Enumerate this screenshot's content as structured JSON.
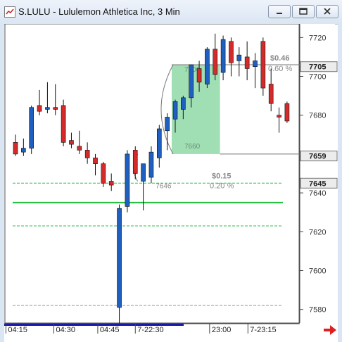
{
  "window": {
    "title": "S.LULU - Lululemon Athletica Inc, 3 Min",
    "minimize_icon": "minimize-icon",
    "restore_icon": "restore-icon",
    "close_icon": "close-icon"
  },
  "chart_data": {
    "type": "candlestick",
    "title": "S.LULU - Lululemon Athletica Inc, 3 Min",
    "ylim": [
      7573,
      7727
    ],
    "y_ticks": [
      7580,
      7600,
      7620,
      7640,
      7660,
      7680,
      7700,
      7720
    ],
    "y_tick_labels": [
      "7580",
      "7600",
      "7620",
      "7640",
      "7660",
      "7680",
      "7700",
      "7720"
    ],
    "x_tick_labels": [
      {
        "label": "04:15",
        "index": 0.3
      },
      {
        "label": "04:30",
        "index": 6.3
      },
      {
        "label": "04:45",
        "index": 11.8
      },
      {
        "label": "7-22:30",
        "index": 16.5
      },
      {
        "label": "23:00",
        "index": 25.8
      },
      {
        "label": "7-23:15",
        "index": 30.6
      }
    ],
    "candles": [
      {
        "o": 7666,
        "h": 7670,
        "l": 7659,
        "c": 7660
      },
      {
        "o": 7661,
        "h": 7668,
        "l": 7659,
        "c": 7663
      },
      {
        "o": 7663,
        "h": 7685,
        "l": 7660,
        "c": 7684
      },
      {
        "o": 7685,
        "h": 7693,
        "l": 7680,
        "c": 7682
      },
      {
        "o": 7683,
        "h": 7697,
        "l": 7681,
        "c": 7684
      },
      {
        "o": 7684,
        "h": 7696,
        "l": 7680,
        "c": 7683
      },
      {
        "o": 7685,
        "h": 7688,
        "l": 7664,
        "c": 7666
      },
      {
        "o": 7667,
        "h": 7671,
        "l": 7663,
        "c": 7665
      },
      {
        "o": 7664,
        "h": 7672,
        "l": 7660,
        "c": 7662
      },
      {
        "o": 7662,
        "h": 7666,
        "l": 7655,
        "c": 7658
      },
      {
        "o": 7658,
        "h": 7660,
        "l": 7649,
        "c": 7655
      },
      {
        "o": 7655,
        "h": 7656,
        "l": 7643,
        "c": 7645
      },
      {
        "o": 7646,
        "h": 7650,
        "l": 7641,
        "c": 7644
      },
      {
        "o": 7581,
        "h": 7634,
        "l": 7569,
        "c": 7632
      },
      {
        "o": 7633,
        "h": 7662,
        "l": 7630,
        "c": 7660
      },
      {
        "o": 7662,
        "h": 7664,
        "l": 7647,
        "c": 7650
      },
      {
        "o": 7646,
        "h": 7655,
        "l": 7631,
        "c": 7655
      },
      {
        "o": 7648,
        "h": 7664,
        "l": 7645,
        "c": 7661
      },
      {
        "o": 7658,
        "h": 7675,
        "l": 7653,
        "c": 7673
      },
      {
        "o": 7672,
        "h": 7681,
        "l": 7662,
        "c": 7679
      },
      {
        "o": 7678,
        "h": 7688,
        "l": 7671,
        "c": 7687
      },
      {
        "o": 7683,
        "h": 7690,
        "l": 7678,
        "c": 7689
      },
      {
        "o": 7689,
        "h": 7706,
        "l": 7684,
        "c": 7706
      },
      {
        "o": 7704,
        "h": 7708,
        "l": 7692,
        "c": 7697
      },
      {
        "o": 7696,
        "h": 7715,
        "l": 7694,
        "c": 7714
      },
      {
        "o": 7714,
        "h": 7722,
        "l": 7698,
        "c": 7701
      },
      {
        "o": 7702,
        "h": 7721,
        "l": 7698,
        "c": 7719
      },
      {
        "o": 7718,
        "h": 7720,
        "l": 7700,
        "c": 7707
      },
      {
        "o": 7708,
        "h": 7715,
        "l": 7700,
        "c": 7711
      },
      {
        "o": 7710,
        "h": 7718,
        "l": 7698,
        "c": 7704
      },
      {
        "o": 7705,
        "h": 7712,
        "l": 7694,
        "c": 7708
      },
      {
        "o": 7718,
        "h": 7720,
        "l": 7690,
        "c": 7694
      },
      {
        "o": 7696,
        "h": 7704,
        "l": 7682,
        "c": 7686
      },
      {
        "o": 7680,
        "h": 7684,
        "l": 7671,
        "c": 7679
      },
      {
        "o": 7686,
        "h": 7687,
        "l": 7676,
        "c": 7677
      }
    ],
    "price_labels": [
      {
        "value": 7705,
        "label": "7705"
      },
      {
        "value": 7659,
        "label": "7659"
      },
      {
        "value": 7645,
        "label": "7645"
      }
    ],
    "horizontal_lines": [
      {
        "value": 7645,
        "style": "dashed",
        "color": "#2fbf4f"
      },
      {
        "value": 7635,
        "style": "solid",
        "color": "#1fbf3a"
      },
      {
        "value": 7623,
        "style": "dashed",
        "color": "#2fbf4f"
      },
      {
        "value": 7582,
        "style": "dashed",
        "color": "#9a9a9a"
      }
    ],
    "measure_boxes": [
      {
        "from_index": 18.5,
        "to_index": 25.6,
        "low": 7660,
        "high": 7706,
        "low_label": "7660",
        "high_label": "7706",
        "change_label": "$0.46",
        "pct_label": "0.60 %"
      },
      {
        "from_index": 15.0,
        "to_index": 27.0,
        "low": 7646,
        "high": 7660,
        "low_label": "7646",
        "change_label": "$0.15",
        "pct_label": "0.20 %"
      }
    ],
    "colors": {
      "up": "#1f5fbf",
      "down": "#d42a2a",
      "measure_fill": "#8fd8a6",
      "grid_text": "#333333",
      "axis_blue": "#1010c0"
    }
  }
}
